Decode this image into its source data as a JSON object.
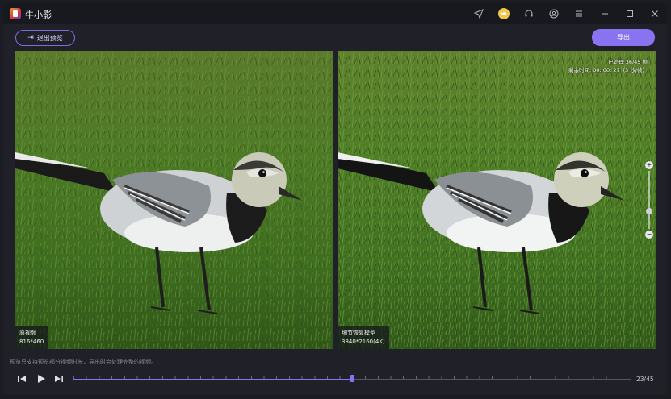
{
  "app": {
    "title": "牛小影"
  },
  "titlebar": {
    "icons": [
      "send-icon",
      "vip-crown-icon",
      "headset-support-icon",
      "user-account-icon",
      "menu-icon",
      "minimize-icon",
      "maximize-icon",
      "close-icon"
    ]
  },
  "toolbar": {
    "exit_preview_label": "退出预览",
    "export_label": "导出"
  },
  "left_pane": {
    "label": "原视频",
    "resolution": "816*460"
  },
  "right_pane": {
    "label": "细节恢复模型",
    "resolution": "3840*2160(4K)",
    "processed": "已处理 36/45 帧",
    "remaining": "剩余时间: 00: 00: 27（3 秒/帧）"
  },
  "zoom": {
    "plus": "+",
    "minus": "−",
    "level": 0.3
  },
  "bottom": {
    "hint": "预览只支持预览部分视频时长，导出时会处理完整的视频。",
    "frame_counter": "23/45",
    "timeline_progress": 0.5
  },
  "colors": {
    "accent": "#8a73f0",
    "background": "#202028"
  }
}
